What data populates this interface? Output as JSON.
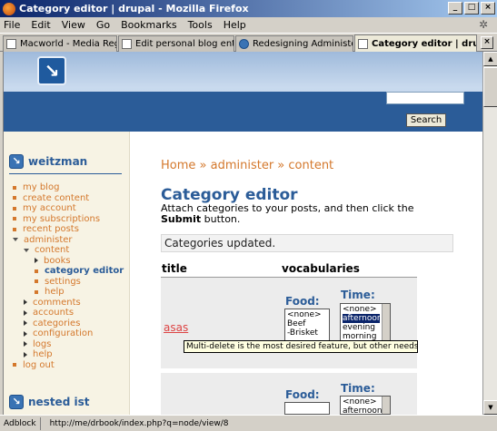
{
  "window": {
    "title": "Category editor | drupal - Mozilla Firefox"
  },
  "menu": [
    "File",
    "Edit",
    "View",
    "Go",
    "Bookmarks",
    "Tools",
    "Help"
  ],
  "tabs": [
    "Macworld - Media Registration",
    "Edit personal blog entry | drupal",
    "Redesigning Administer Conte...",
    "Category editor | drupal"
  ],
  "header": {
    "search_button": "Search"
  },
  "sidebar": {
    "user_block_title": "weitzman",
    "nav": {
      "my_blog": "my blog",
      "create_content": "create content",
      "my_account": "my account",
      "my_subscriptions": "my subscriptions",
      "recent_posts": "recent posts",
      "administer": "administer",
      "content": "content",
      "books": "books",
      "category_editor": "category editor",
      "settings": "settings",
      "help_sub": "help",
      "comments": "comments",
      "accounts": "accounts",
      "categories": "categories",
      "configuration": "configuration",
      "logs": "logs",
      "help": "help",
      "log_out": "log out"
    },
    "second_block_title": "nested ist"
  },
  "main": {
    "breadcrumb": "Home » administer » content",
    "title": "Category editor",
    "intro_pre": "Attach categories to your posts, and then click the ",
    "intro_bold": "Submit",
    "intro_post": " button.",
    "status": "Categories updated.",
    "col_title": "title",
    "col_vocab": "vocabularies",
    "row1": {
      "term": "asas",
      "food_label": "Food:",
      "food_options": [
        "<none>",
        "Beef",
        "-Brisket"
      ],
      "time_label": "Time:",
      "time_options": [
        "<none>",
        "afternoon",
        "evening",
        "morning"
      ]
    },
    "row2": {
      "food_label": "Food:",
      "time_label": "Time:",
      "time_options": [
        "<none>",
        "afternoon"
      ]
    }
  },
  "tooltip": "Multi-delete is the most desired feature, but other needs such as multi-categori",
  "statusbar": {
    "adblock": "Adblock",
    "url": "http://me/drbook/index.php?q=node/view/8"
  }
}
